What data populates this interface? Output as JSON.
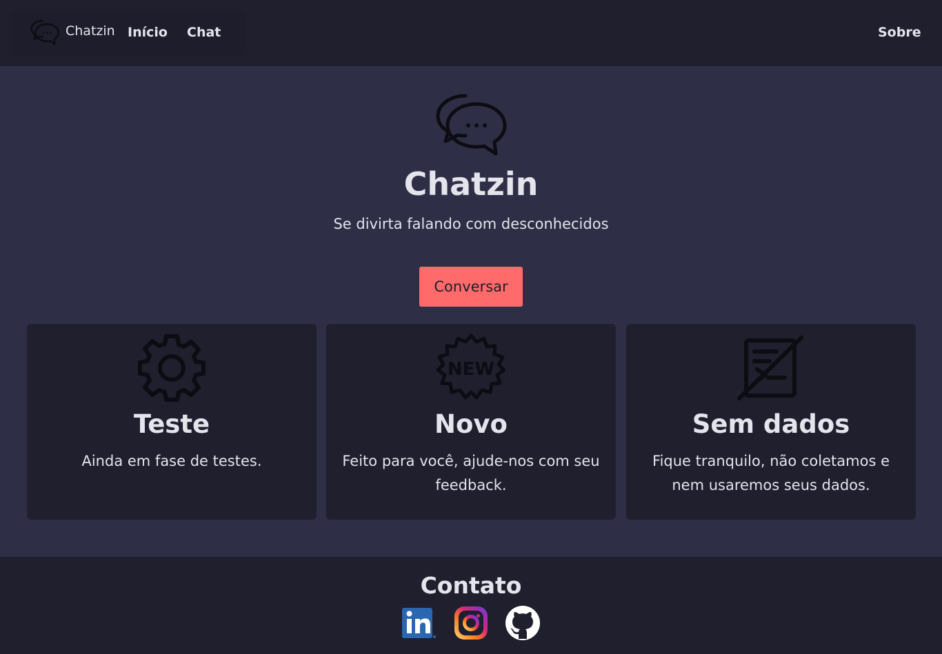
{
  "navbar": {
    "brand": "Chatzin",
    "links": [
      "Início",
      "Chat"
    ],
    "right_link": "Sobre"
  },
  "hero": {
    "icon": "chat-bubbles-icon",
    "title": "Chatzin",
    "subtitle": "Se divirta falando com desconhecidos",
    "cta_label": "Conversar"
  },
  "features": [
    {
      "icon": "gear-icon",
      "title": "Teste",
      "text": "Ainda em fase de testes."
    },
    {
      "icon": "new-badge-icon",
      "title": "Novo",
      "text": "Feito para você, ajude-nos com seu feedback."
    },
    {
      "icon": "no-data-icon",
      "title": "Sem dados",
      "text": "Fique tranquilo, não coletamos e nem usaremos seus dados."
    }
  ],
  "footer": {
    "title": "Contato",
    "socials": [
      "linkedin-icon",
      "instagram-icon",
      "github-icon"
    ]
  },
  "colors": {
    "background": "#2e2f46",
    "panel": "#1f1f2e",
    "accent": "#ff6b6b",
    "text": "#e4e4ec"
  }
}
